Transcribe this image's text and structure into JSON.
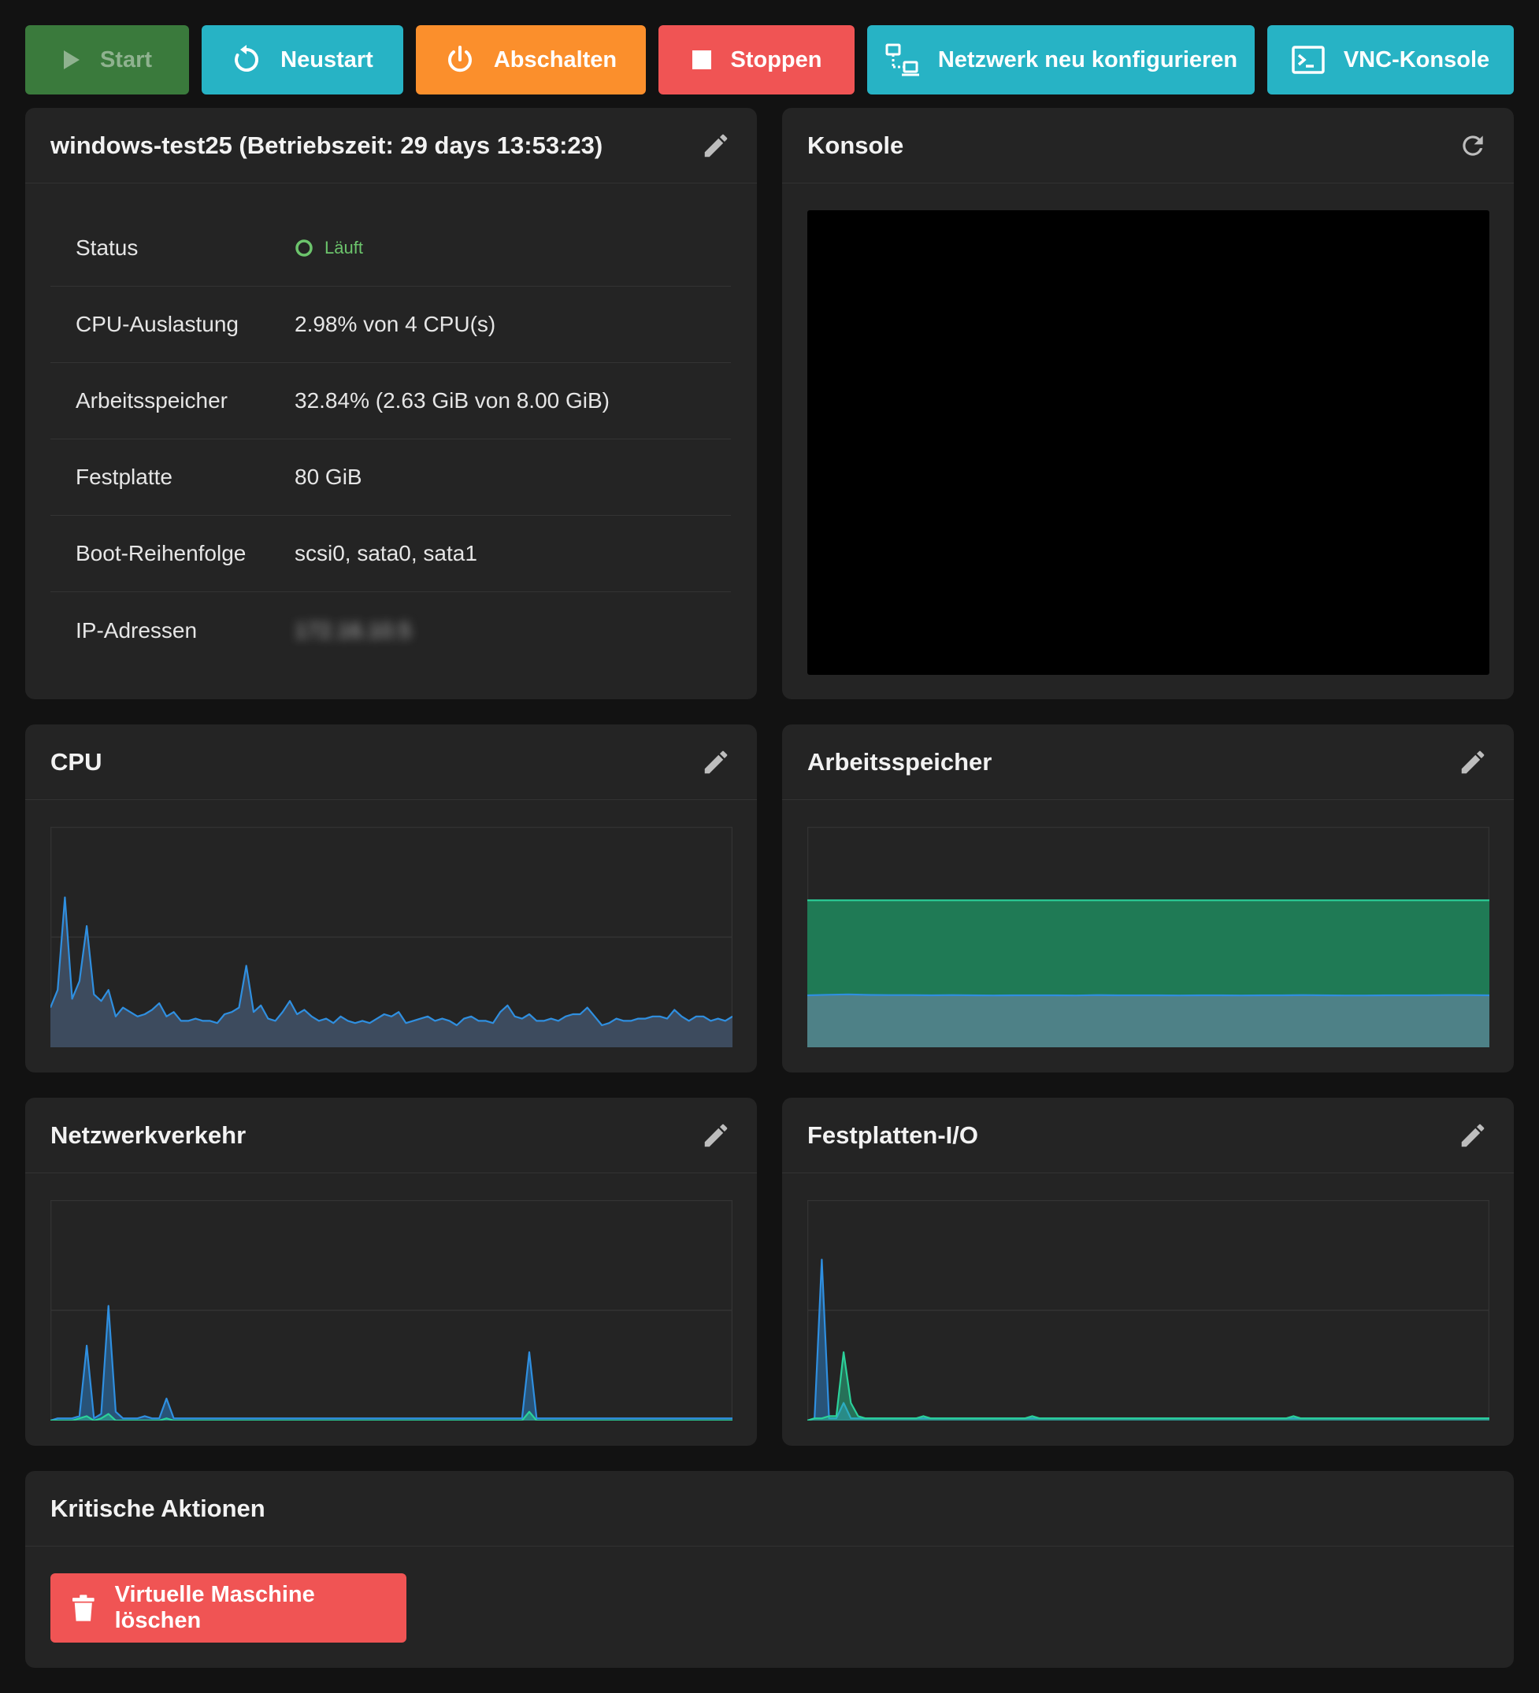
{
  "toolbar": {
    "start": "Start",
    "restart": "Neustart",
    "shutdown": "Abschalten",
    "stop": "Stoppen",
    "network": "Netzwerk neu konfigurieren",
    "vnc": "VNC-Konsole"
  },
  "vm_card": {
    "title": "windows-test25 (Betriebszeit: 29 days 13:53:23)",
    "rows": [
      {
        "label": "Status",
        "value": "Läuft"
      },
      {
        "label": "CPU-Auslastung",
        "value": "2.98% von 4 CPU(s)"
      },
      {
        "label": "Arbeitsspeicher",
        "value": "32.84% (2.63 GiB von 8.00 GiB)"
      },
      {
        "label": "Festplatte",
        "value": "80 GiB"
      },
      {
        "label": "Boot-Reihenfolge",
        "value": "scsi0, sata0, sata1"
      },
      {
        "label": "IP-Adressen",
        "value": "172.16.10.5"
      }
    ]
  },
  "console_card": {
    "title": "Konsole"
  },
  "cpu_card": {
    "title": "CPU"
  },
  "memory_card": {
    "title": "Arbeitsspeicher"
  },
  "network_card": {
    "title": "Netzwerkverkehr"
  },
  "disk_card": {
    "title": "Festplatten-I/O"
  },
  "critical_card": {
    "title": "Kritische Aktionen",
    "delete_button": "Virtuelle Maschine löschen"
  },
  "colors": {
    "running": "#6cc46c",
    "accent": "#27b3c5",
    "danger": "#f05454",
    "warning": "#fb8f2c",
    "start": "#3a7a3c",
    "series_blue": "#2f8fe0",
    "series_green": "#2bd19a"
  },
  "icons": {
    "start": "play-icon",
    "restart": "restart-icon",
    "shutdown": "power-icon",
    "stop": "stop-icon",
    "network": "network-icon",
    "vnc": "terminal-icon",
    "edit": "pencil-icon",
    "refresh": "refresh-icon",
    "status": "status-ring-icon",
    "delete": "trash-icon"
  },
  "chart_data": [
    {
      "type": "area",
      "title": "CPU",
      "ylim": [
        0,
        100
      ],
      "series": [
        {
          "values": [
            18,
            26,
            68,
            22,
            30,
            55,
            24,
            21,
            26,
            14,
            18,
            16,
            14,
            15,
            17,
            20,
            14,
            16,
            12,
            12,
            13,
            12,
            12,
            11,
            15,
            16,
            18,
            37,
            16,
            19,
            13,
            12,
            16,
            21,
            15,
            17,
            14,
            12,
            13,
            11,
            14,
            12,
            11,
            12,
            11,
            13,
            15,
            14,
            16,
            11,
            12,
            13,
            14,
            12,
            13,
            12,
            10,
            13,
            14,
            12,
            12,
            11,
            16,
            19,
            14,
            13,
            15,
            12,
            12,
            13,
            12,
            14,
            15,
            15,
            18,
            14,
            10,
            11,
            13,
            12,
            12,
            13,
            13,
            14,
            14,
            13,
            17,
            14,
            12,
            14,
            14,
            12,
            13,
            12,
            14
          ]
        }
      ]
    },
    {
      "type": "area",
      "title": "Arbeitsspeicher",
      "ylim": [
        0,
        12
      ],
      "series": [
        {
          "values": [
            2.83,
            2.86,
            2.88,
            2.85,
            2.84,
            2.84,
            2.83,
            2.84,
            2.83,
            2.82,
            2.83,
            2.83,
            2.83,
            2.82,
            2.84,
            2.83,
            2.83,
            2.83,
            2.82,
            2.83,
            2.83,
            2.82,
            2.83,
            2.83,
            2.84,
            2.83,
            2.82,
            2.82,
            2.83,
            2.83,
            2.83,
            2.84,
            2.84,
            2.83
          ]
        },
        {
          "values": [
            8,
            8,
            8,
            8,
            8,
            8,
            8,
            8,
            8,
            8,
            8,
            8,
            8,
            8,
            8,
            8,
            8,
            8,
            8,
            8,
            8,
            8,
            8,
            8,
            8,
            8,
            8,
            8,
            8,
            8,
            8,
            8,
            8,
            8
          ]
        }
      ]
    },
    {
      "type": "area",
      "title": "Netzwerkverkehr",
      "ylim": [
        0,
        100
      ],
      "series": [
        {
          "values": [
            0,
            1,
            1,
            1,
            2,
            34,
            1,
            3,
            52,
            4,
            1,
            1,
            1,
            2,
            1,
            1,
            10,
            1,
            1,
            1,
            1,
            1,
            1,
            1,
            1,
            1,
            1,
            1,
            1,
            1,
            1,
            1,
            1,
            1,
            1,
            1,
            1,
            1,
            1,
            1,
            1,
            1,
            1,
            1,
            1,
            1,
            1,
            1,
            1,
            1,
            1,
            1,
            1,
            1,
            1,
            1,
            1,
            1,
            1,
            1,
            1,
            1,
            1,
            1,
            1,
            1,
            31,
            1,
            1,
            1,
            1,
            1,
            1,
            1,
            1,
            1,
            1,
            1,
            1,
            1,
            1,
            1,
            1,
            1,
            1,
            1,
            1,
            1,
            1,
            1,
            1,
            1,
            1,
            1,
            1
          ]
        },
        {
          "values": [
            0,
            0,
            0,
            0,
            1,
            2,
            0,
            1,
            3,
            0,
            0,
            0,
            0,
            0,
            0,
            0,
            1,
            0,
            0,
            0,
            0,
            0,
            0,
            0,
            0,
            0,
            0,
            0,
            0,
            0,
            0,
            0,
            0,
            0,
            0,
            0,
            0,
            0,
            0,
            0,
            0,
            0,
            0,
            0,
            0,
            0,
            0,
            0,
            0,
            0,
            0,
            0,
            0,
            0,
            0,
            0,
            0,
            0,
            0,
            0,
            0,
            0,
            0,
            0,
            0,
            0,
            4,
            0,
            0,
            0,
            0,
            0,
            0,
            0,
            0,
            0,
            0,
            0,
            0,
            0,
            0,
            0,
            0,
            0,
            0,
            0,
            0,
            0,
            0,
            0,
            0,
            0,
            0,
            0,
            0
          ]
        }
      ]
    },
    {
      "type": "area",
      "title": "Festplatten-I/O",
      "ylim": [
        0,
        100
      ],
      "series": [
        {
          "values": [
            0,
            1,
            73,
            1,
            1,
            8,
            1,
            1,
            1,
            1,
            1,
            1,
            1,
            1,
            1,
            1,
            1,
            1,
            1,
            1,
            1,
            1,
            1,
            1,
            1,
            1,
            1,
            1,
            1,
            1,
            1,
            1,
            1,
            1,
            1,
            1,
            1,
            1,
            1,
            1,
            1,
            1,
            1,
            1,
            1,
            1,
            1,
            1,
            1,
            1,
            1,
            1,
            1,
            1,
            1,
            1,
            1,
            1,
            1,
            1,
            1,
            1,
            1,
            1,
            1,
            1,
            1,
            1,
            1,
            1,
            1,
            1,
            1,
            1,
            1,
            1,
            1,
            1,
            1,
            1,
            1,
            1,
            1,
            1,
            1,
            1,
            1,
            1,
            1,
            1,
            1,
            1,
            1,
            1,
            1
          ]
        },
        {
          "values": [
            0,
            1,
            1,
            2,
            2,
            31,
            8,
            2,
            1,
            1,
            1,
            1,
            1,
            1,
            1,
            1,
            2,
            1,
            1,
            1,
            1,
            1,
            1,
            1,
            1,
            1,
            1,
            1,
            1,
            1,
            1,
            2,
            1,
            1,
            1,
            1,
            1,
            1,
            1,
            1,
            1,
            1,
            1,
            1,
            1,
            1,
            1,
            1,
            1,
            1,
            1,
            1,
            1,
            1,
            1,
            1,
            1,
            1,
            1,
            1,
            1,
            1,
            1,
            1,
            1,
            1,
            1,
            2,
            1,
            1,
            1,
            1,
            1,
            1,
            1,
            1,
            1,
            1,
            1,
            1,
            1,
            1,
            1,
            1,
            1,
            1,
            1,
            1,
            1,
            1,
            1,
            1,
            1,
            1,
            1
          ]
        }
      ]
    }
  ]
}
